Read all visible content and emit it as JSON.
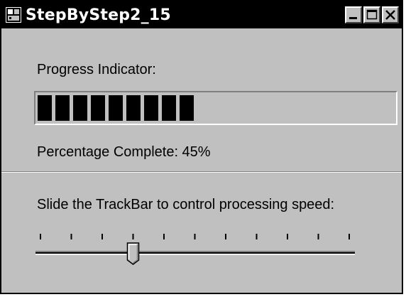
{
  "window": {
    "title": "StepByStep2_15",
    "controls": {
      "minimize": "minimize-icon",
      "maximize": "maximize-icon",
      "close": "close-icon"
    }
  },
  "progress": {
    "label": "Progress Indicator:",
    "value": 0.45,
    "segments_total": 20,
    "percent_text": "Percentage Complete: 45%"
  },
  "trackbar": {
    "label": "Slide the TrackBar to control processing speed:",
    "ticks": 11,
    "value": 3,
    "max": 10
  },
  "colors": {
    "face": "#c0c0c0",
    "title_bg": "#000000",
    "progress_fill": "#000000"
  }
}
